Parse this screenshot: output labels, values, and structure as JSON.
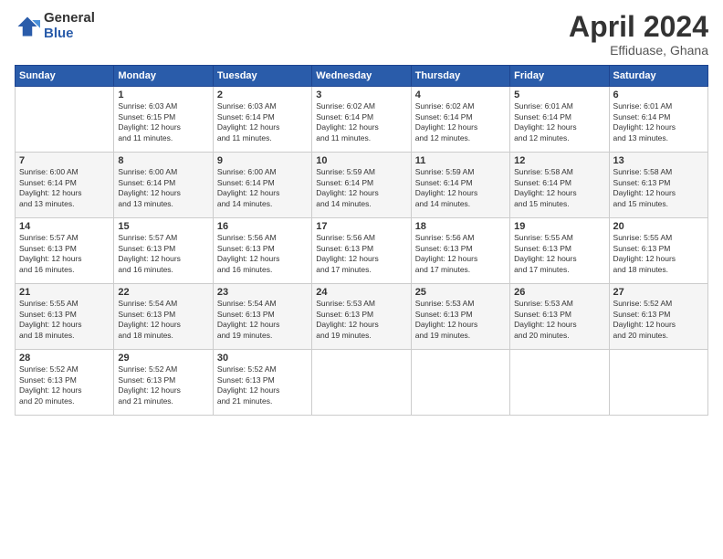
{
  "logo": {
    "general": "General",
    "blue": "Blue"
  },
  "header": {
    "title": "April 2024",
    "subtitle": "Effiduase, Ghana"
  },
  "calendar": {
    "days_of_week": [
      "Sunday",
      "Monday",
      "Tuesday",
      "Wednesday",
      "Thursday",
      "Friday",
      "Saturday"
    ],
    "weeks": [
      [
        {
          "day": "",
          "info": ""
        },
        {
          "day": "1",
          "info": "Sunrise: 6:03 AM\nSunset: 6:15 PM\nDaylight: 12 hours\nand 11 minutes."
        },
        {
          "day": "2",
          "info": "Sunrise: 6:03 AM\nSunset: 6:14 PM\nDaylight: 12 hours\nand 11 minutes."
        },
        {
          "day": "3",
          "info": "Sunrise: 6:02 AM\nSunset: 6:14 PM\nDaylight: 12 hours\nand 11 minutes."
        },
        {
          "day": "4",
          "info": "Sunrise: 6:02 AM\nSunset: 6:14 PM\nDaylight: 12 hours\nand 12 minutes."
        },
        {
          "day": "5",
          "info": "Sunrise: 6:01 AM\nSunset: 6:14 PM\nDaylight: 12 hours\nand 12 minutes."
        },
        {
          "day": "6",
          "info": "Sunrise: 6:01 AM\nSunset: 6:14 PM\nDaylight: 12 hours\nand 13 minutes."
        }
      ],
      [
        {
          "day": "7",
          "info": "Sunrise: 6:00 AM\nSunset: 6:14 PM\nDaylight: 12 hours\nand 13 minutes."
        },
        {
          "day": "8",
          "info": "Sunrise: 6:00 AM\nSunset: 6:14 PM\nDaylight: 12 hours\nand 13 minutes."
        },
        {
          "day": "9",
          "info": "Sunrise: 6:00 AM\nSunset: 6:14 PM\nDaylight: 12 hours\nand 14 minutes."
        },
        {
          "day": "10",
          "info": "Sunrise: 5:59 AM\nSunset: 6:14 PM\nDaylight: 12 hours\nand 14 minutes."
        },
        {
          "day": "11",
          "info": "Sunrise: 5:59 AM\nSunset: 6:14 PM\nDaylight: 12 hours\nand 14 minutes."
        },
        {
          "day": "12",
          "info": "Sunrise: 5:58 AM\nSunset: 6:14 PM\nDaylight: 12 hours\nand 15 minutes."
        },
        {
          "day": "13",
          "info": "Sunrise: 5:58 AM\nSunset: 6:13 PM\nDaylight: 12 hours\nand 15 minutes."
        }
      ],
      [
        {
          "day": "14",
          "info": "Sunrise: 5:57 AM\nSunset: 6:13 PM\nDaylight: 12 hours\nand 16 minutes."
        },
        {
          "day": "15",
          "info": "Sunrise: 5:57 AM\nSunset: 6:13 PM\nDaylight: 12 hours\nand 16 minutes."
        },
        {
          "day": "16",
          "info": "Sunrise: 5:56 AM\nSunset: 6:13 PM\nDaylight: 12 hours\nand 16 minutes."
        },
        {
          "day": "17",
          "info": "Sunrise: 5:56 AM\nSunset: 6:13 PM\nDaylight: 12 hours\nand 17 minutes."
        },
        {
          "day": "18",
          "info": "Sunrise: 5:56 AM\nSunset: 6:13 PM\nDaylight: 12 hours\nand 17 minutes."
        },
        {
          "day": "19",
          "info": "Sunrise: 5:55 AM\nSunset: 6:13 PM\nDaylight: 12 hours\nand 17 minutes."
        },
        {
          "day": "20",
          "info": "Sunrise: 5:55 AM\nSunset: 6:13 PM\nDaylight: 12 hours\nand 18 minutes."
        }
      ],
      [
        {
          "day": "21",
          "info": "Sunrise: 5:55 AM\nSunset: 6:13 PM\nDaylight: 12 hours\nand 18 minutes."
        },
        {
          "day": "22",
          "info": "Sunrise: 5:54 AM\nSunset: 6:13 PM\nDaylight: 12 hours\nand 18 minutes."
        },
        {
          "day": "23",
          "info": "Sunrise: 5:54 AM\nSunset: 6:13 PM\nDaylight: 12 hours\nand 19 minutes."
        },
        {
          "day": "24",
          "info": "Sunrise: 5:53 AM\nSunset: 6:13 PM\nDaylight: 12 hours\nand 19 minutes."
        },
        {
          "day": "25",
          "info": "Sunrise: 5:53 AM\nSunset: 6:13 PM\nDaylight: 12 hours\nand 19 minutes."
        },
        {
          "day": "26",
          "info": "Sunrise: 5:53 AM\nSunset: 6:13 PM\nDaylight: 12 hours\nand 20 minutes."
        },
        {
          "day": "27",
          "info": "Sunrise: 5:52 AM\nSunset: 6:13 PM\nDaylight: 12 hours\nand 20 minutes."
        }
      ],
      [
        {
          "day": "28",
          "info": "Sunrise: 5:52 AM\nSunset: 6:13 PM\nDaylight: 12 hours\nand 20 minutes."
        },
        {
          "day": "29",
          "info": "Sunrise: 5:52 AM\nSunset: 6:13 PM\nDaylight: 12 hours\nand 21 minutes."
        },
        {
          "day": "30",
          "info": "Sunrise: 5:52 AM\nSunset: 6:13 PM\nDaylight: 12 hours\nand 21 minutes."
        },
        {
          "day": "",
          "info": ""
        },
        {
          "day": "",
          "info": ""
        },
        {
          "day": "",
          "info": ""
        },
        {
          "day": "",
          "info": ""
        }
      ]
    ]
  }
}
